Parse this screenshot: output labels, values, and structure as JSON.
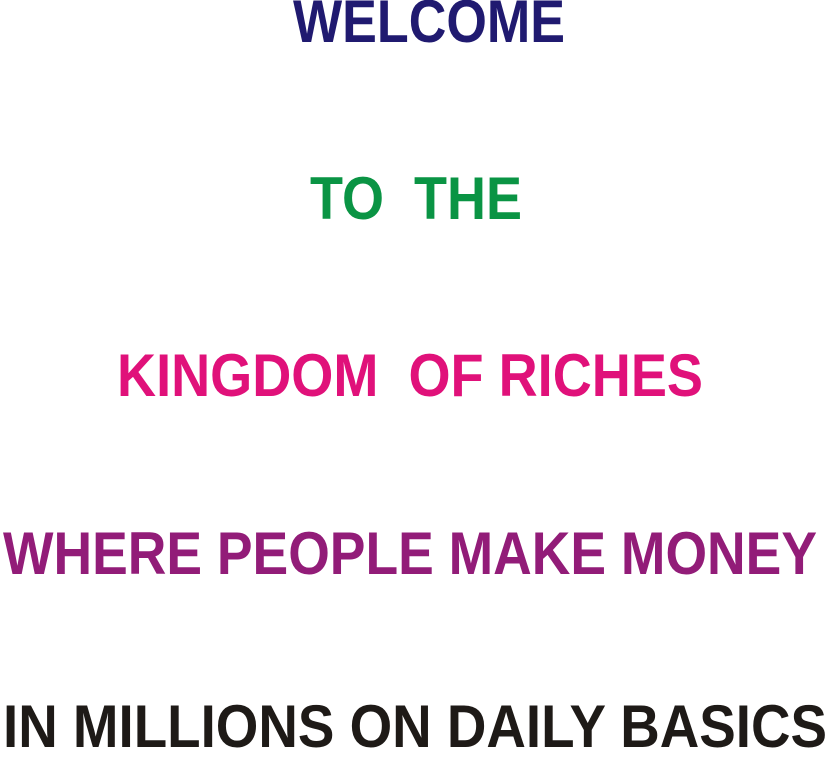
{
  "lines": [
    {
      "text": "WELCOME",
      "color": "#201a70"
    },
    {
      "text": "TO  THE",
      "color": "#0a9444"
    },
    {
      "text": "KINGDOM  OF RICHES",
      "color": "#e0117a"
    },
    {
      "text": "WHERE PEOPLE MAKE MONEY",
      "color": "#921c78"
    },
    {
      "text": "IN MILLIONS ON DAILY BASICS",
      "color": "#1e1a17"
    }
  ]
}
